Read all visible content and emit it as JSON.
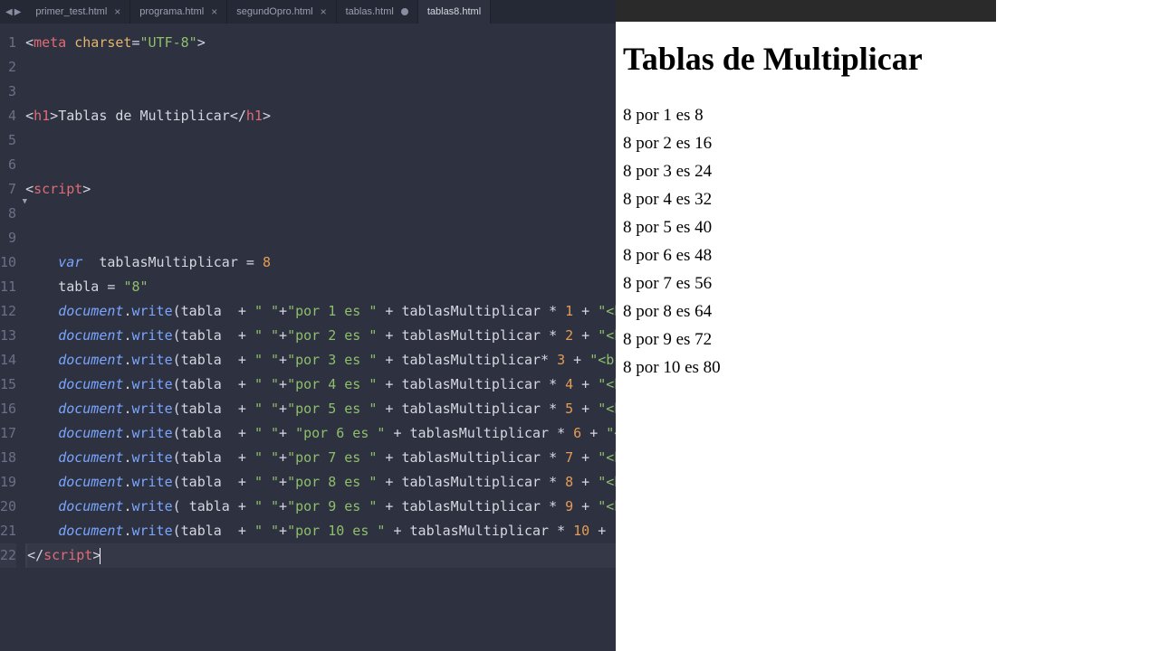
{
  "tabs": {
    "items": [
      {
        "label": "primer_test.html",
        "active": false,
        "closeIcon": "×"
      },
      {
        "label": "programa.html",
        "active": false,
        "closeIcon": "×"
      },
      {
        "label": "segundOpro.html",
        "active": false,
        "closeIcon": "×"
      },
      {
        "label": "tablas.html",
        "active": false,
        "closeIcon": "•"
      },
      {
        "label": "tablas8.html",
        "active": true,
        "closeIcon": ""
      }
    ],
    "nav_left": "◀",
    "nav_right": "▶"
  },
  "editor": {
    "line_count": 22,
    "fold_line": 7,
    "active_line": 22,
    "code": {
      "l1": {
        "pre": "<",
        "tag": "meta",
        "sp": " ",
        "attr": "charset",
        "eq": "=",
        "val": "\"UTF-8\"",
        "post": ">"
      },
      "l4": {
        "pre": "<",
        "tag": "h1",
        "mid": ">",
        "text": "Tablas de Multiplicar",
        "pre2": "</",
        "tag2": "h1",
        "post": ">"
      },
      "l7": {
        "pre": "<",
        "tag": "script",
        "post": ">"
      },
      "l10": {
        "kw": "var",
        "sp": "  ",
        "id": "tablasMultiplicar",
        "op": " = ",
        "num": "8"
      },
      "l11": {
        "id": "tabla",
        "op": " = ",
        "str": "\"8\""
      },
      "dw_lines": [
        {
          "ln": 12,
          "pad": " ",
          "arg_str1": "\" \"",
          "plus1": "+",
          "arg_str2": "\"por 1 es \"",
          "mult_sp": " ",
          "mult_num": "1",
          "tail_sp": " "
        },
        {
          "ln": 13,
          "pad": " ",
          "arg_str1": "\" \"",
          "plus1": "+",
          "arg_str2": "\"por 2 es \"",
          "mult_sp": " ",
          "mult_num": "2",
          "tail_sp": " "
        },
        {
          "ln": 14,
          "pad": " ",
          "arg_str1": "\" \"",
          "plus1": "+",
          "arg_str2": "\"por 3 es \"",
          "mult_sp": "",
          "mult_num": "3",
          "tail_sp": " "
        },
        {
          "ln": 15,
          "pad": " ",
          "arg_str1": "\" \"",
          "plus1": "+",
          "arg_str2": "\"por 4 es \"",
          "mult_sp": " ",
          "mult_num": "4",
          "tail_sp": " "
        },
        {
          "ln": 16,
          "pad": " ",
          "arg_str1": "\" \"",
          "plus1": "+",
          "arg_str2": "\"por 5 es \"",
          "mult_sp": " ",
          "mult_num": "5",
          "tail_sp": " "
        },
        {
          "ln": 17,
          "pad": " ",
          "arg_str1": "\" \"",
          "plus1": "+ ",
          "arg_str2": "\"por 6 es \"",
          "mult_sp": " ",
          "mult_num": "6",
          "tail_sp": " "
        },
        {
          "ln": 18,
          "pad": " ",
          "arg_str1": "\" \"",
          "plus1": "+",
          "arg_str2": "\"por 7 es \"",
          "mult_sp": " ",
          "mult_num": "7",
          "tail_sp": " "
        },
        {
          "ln": 19,
          "pad": " ",
          "arg_str1": "\" \"",
          "plus1": "+",
          "arg_str2": "\"por 8 es \"",
          "mult_sp": " ",
          "mult_num": "8",
          "tail_sp": " "
        },
        {
          "ln": 20,
          "pad": " ",
          "pre_tabla": " ",
          "post_tabla": "",
          "arg_str1": "\" \"",
          "plus1": "+",
          "arg_str2": "\"por 9 es \"",
          "mult_sp": " ",
          "mult_num": "9",
          "tail_sp": " "
        },
        {
          "ln": 21,
          "pad": " ",
          "arg_str1": "\" \"",
          "plus1": "+",
          "arg_str2": "\"por 10 es \"",
          "mult_sp": " ",
          "mult_num": "10",
          "tail_sp": " "
        }
      ],
      "dw_common": {
        "obj": "document",
        "dot": ".",
        "fn": "write",
        "open": "(",
        "tabla": "tabla",
        "plus": " +",
        "plus2": " + ",
        "mult_id": "tablasMultiplicar",
        "star": " * ",
        "star_ns": "* ",
        "plus3": " + ",
        "br": "\"<br>\"",
        "close": ");"
      },
      "l22": {
        "pre": "</",
        "tag": "script",
        "post": ">"
      }
    }
  },
  "browser": {
    "heading": "Tablas de Multiplicar",
    "lines": [
      "8 por 1 es 8",
      "8 por 2 es 16",
      "8 por 3 es 24",
      "8 por 4 es 32",
      "8 por 5 es 40",
      "8 por 6 es 48",
      "8 por 7 es 56",
      "8 por 8 es 64",
      "8 por 9 es 72",
      "8 por 10 es 80"
    ]
  }
}
